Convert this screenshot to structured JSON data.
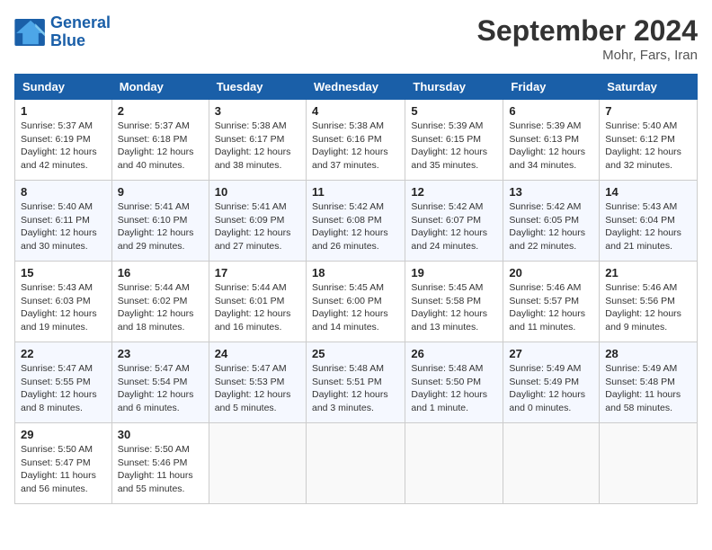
{
  "header": {
    "logo_line1": "General",
    "logo_line2": "Blue",
    "month_title": "September 2024",
    "location": "Mohr, Fars, Iran"
  },
  "weekdays": [
    "Sunday",
    "Monday",
    "Tuesday",
    "Wednesday",
    "Thursday",
    "Friday",
    "Saturday"
  ],
  "weeks": [
    [
      {
        "day": "1",
        "info": "Sunrise: 5:37 AM\nSunset: 6:19 PM\nDaylight: 12 hours\nand 42 minutes."
      },
      {
        "day": "2",
        "info": "Sunrise: 5:37 AM\nSunset: 6:18 PM\nDaylight: 12 hours\nand 40 minutes."
      },
      {
        "day": "3",
        "info": "Sunrise: 5:38 AM\nSunset: 6:17 PM\nDaylight: 12 hours\nand 38 minutes."
      },
      {
        "day": "4",
        "info": "Sunrise: 5:38 AM\nSunset: 6:16 PM\nDaylight: 12 hours\nand 37 minutes."
      },
      {
        "day": "5",
        "info": "Sunrise: 5:39 AM\nSunset: 6:15 PM\nDaylight: 12 hours\nand 35 minutes."
      },
      {
        "day": "6",
        "info": "Sunrise: 5:39 AM\nSunset: 6:13 PM\nDaylight: 12 hours\nand 34 minutes."
      },
      {
        "day": "7",
        "info": "Sunrise: 5:40 AM\nSunset: 6:12 PM\nDaylight: 12 hours\nand 32 minutes."
      }
    ],
    [
      {
        "day": "8",
        "info": "Sunrise: 5:40 AM\nSunset: 6:11 PM\nDaylight: 12 hours\nand 30 minutes."
      },
      {
        "day": "9",
        "info": "Sunrise: 5:41 AM\nSunset: 6:10 PM\nDaylight: 12 hours\nand 29 minutes."
      },
      {
        "day": "10",
        "info": "Sunrise: 5:41 AM\nSunset: 6:09 PM\nDaylight: 12 hours\nand 27 minutes."
      },
      {
        "day": "11",
        "info": "Sunrise: 5:42 AM\nSunset: 6:08 PM\nDaylight: 12 hours\nand 26 minutes."
      },
      {
        "day": "12",
        "info": "Sunrise: 5:42 AM\nSunset: 6:07 PM\nDaylight: 12 hours\nand 24 minutes."
      },
      {
        "day": "13",
        "info": "Sunrise: 5:42 AM\nSunset: 6:05 PM\nDaylight: 12 hours\nand 22 minutes."
      },
      {
        "day": "14",
        "info": "Sunrise: 5:43 AM\nSunset: 6:04 PM\nDaylight: 12 hours\nand 21 minutes."
      }
    ],
    [
      {
        "day": "15",
        "info": "Sunrise: 5:43 AM\nSunset: 6:03 PM\nDaylight: 12 hours\nand 19 minutes."
      },
      {
        "day": "16",
        "info": "Sunrise: 5:44 AM\nSunset: 6:02 PM\nDaylight: 12 hours\nand 18 minutes."
      },
      {
        "day": "17",
        "info": "Sunrise: 5:44 AM\nSunset: 6:01 PM\nDaylight: 12 hours\nand 16 minutes."
      },
      {
        "day": "18",
        "info": "Sunrise: 5:45 AM\nSunset: 6:00 PM\nDaylight: 12 hours\nand 14 minutes."
      },
      {
        "day": "19",
        "info": "Sunrise: 5:45 AM\nSunset: 5:58 PM\nDaylight: 12 hours\nand 13 minutes."
      },
      {
        "day": "20",
        "info": "Sunrise: 5:46 AM\nSunset: 5:57 PM\nDaylight: 12 hours\nand 11 minutes."
      },
      {
        "day": "21",
        "info": "Sunrise: 5:46 AM\nSunset: 5:56 PM\nDaylight: 12 hours\nand 9 minutes."
      }
    ],
    [
      {
        "day": "22",
        "info": "Sunrise: 5:47 AM\nSunset: 5:55 PM\nDaylight: 12 hours\nand 8 minutes."
      },
      {
        "day": "23",
        "info": "Sunrise: 5:47 AM\nSunset: 5:54 PM\nDaylight: 12 hours\nand 6 minutes."
      },
      {
        "day": "24",
        "info": "Sunrise: 5:47 AM\nSunset: 5:53 PM\nDaylight: 12 hours\nand 5 minutes."
      },
      {
        "day": "25",
        "info": "Sunrise: 5:48 AM\nSunset: 5:51 PM\nDaylight: 12 hours\nand 3 minutes."
      },
      {
        "day": "26",
        "info": "Sunrise: 5:48 AM\nSunset: 5:50 PM\nDaylight: 12 hours\nand 1 minute."
      },
      {
        "day": "27",
        "info": "Sunrise: 5:49 AM\nSunset: 5:49 PM\nDaylight: 12 hours\nand 0 minutes."
      },
      {
        "day": "28",
        "info": "Sunrise: 5:49 AM\nSunset: 5:48 PM\nDaylight: 11 hours\nand 58 minutes."
      }
    ],
    [
      {
        "day": "29",
        "info": "Sunrise: 5:50 AM\nSunset: 5:47 PM\nDaylight: 11 hours\nand 56 minutes."
      },
      {
        "day": "30",
        "info": "Sunrise: 5:50 AM\nSunset: 5:46 PM\nDaylight: 11 hours\nand 55 minutes."
      },
      {
        "day": "",
        "info": ""
      },
      {
        "day": "",
        "info": ""
      },
      {
        "day": "",
        "info": ""
      },
      {
        "day": "",
        "info": ""
      },
      {
        "day": "",
        "info": ""
      }
    ]
  ]
}
